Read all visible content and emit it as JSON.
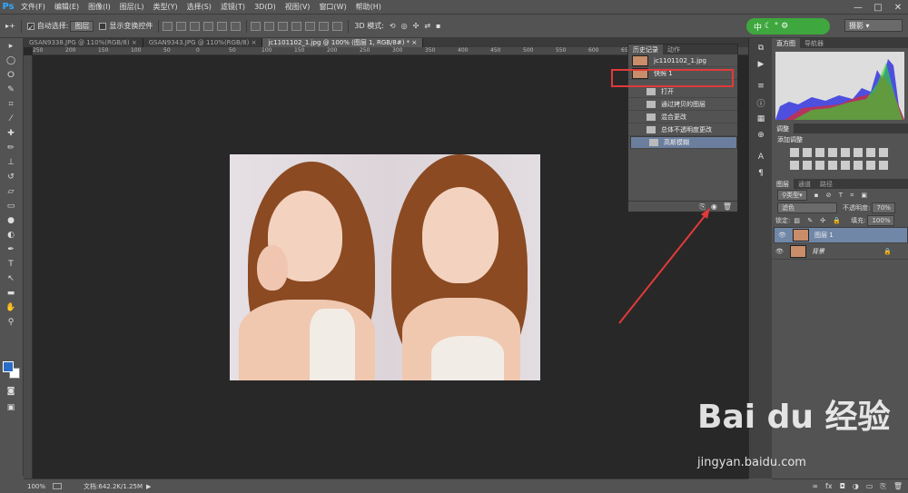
{
  "app": {
    "logo": "Ps"
  },
  "menu": [
    "文件(F)",
    "编辑(E)",
    "图像(I)",
    "图层(L)",
    "类型(Y)",
    "选择(S)",
    "滤镜(T)",
    "3D(D)",
    "视图(V)",
    "窗口(W)",
    "帮助(H)"
  ],
  "window_controls": {
    "minimize": "—",
    "maximize": "□",
    "close": "✕"
  },
  "options": {
    "auto_select_label": "自动选择:",
    "auto_select_value": "图层",
    "show_transform_label": "显示变换控件",
    "mode_3d_label": "3D 模式:",
    "workspace": "摄影"
  },
  "ime": {
    "label": "中"
  },
  "doc_tabs": [
    {
      "label": "GSAN9338.JPG @ 110%(RGB/8)",
      "close": "×"
    },
    {
      "label": "GSAN9343.JPG @ 110%(RGB/8)",
      "close": "×"
    },
    {
      "label": "jc1101102_1.jpg @ 100% (图层 1, RGB/8#) *",
      "close": "×"
    }
  ],
  "ruler_ticks": [
    "250",
    "200",
    "150",
    "100",
    "50",
    "0",
    "50",
    "100",
    "150",
    "200",
    "250",
    "300",
    "350",
    "400",
    "450",
    "500",
    "550",
    "600",
    "650",
    "700",
    "750",
    "800"
  ],
  "status": {
    "zoom": "100%",
    "doc_info": "文档:642.2K/1.25M"
  },
  "history_panel": {
    "tabs": [
      "历史记录",
      "动作"
    ],
    "snapshot_file": "jc1101102_1.jpg",
    "snapshot_1": "快照 1",
    "steps": [
      "打开",
      "通过拷贝的图层",
      "混合更改",
      "总体不透明度更改",
      "高斯模糊"
    ]
  },
  "right_panels": {
    "top_tabs": [
      "直方图",
      "导航器"
    ],
    "adjust_title": "调整",
    "adjust_subtitle": "添加调整",
    "layers_tabs": [
      "图层",
      "通道",
      "路径"
    ],
    "kind_filter": "类型",
    "blend_mode": "滤色",
    "opacity_label": "不透明度:",
    "opacity_value": "70%",
    "lock_label": "锁定:",
    "fill_label": "填充:",
    "fill_value": "100%",
    "layers": [
      "图层 1",
      "背景"
    ]
  },
  "watermark": {
    "brand": "Bai du 经验",
    "url": "jingyan.baidu.com"
  }
}
